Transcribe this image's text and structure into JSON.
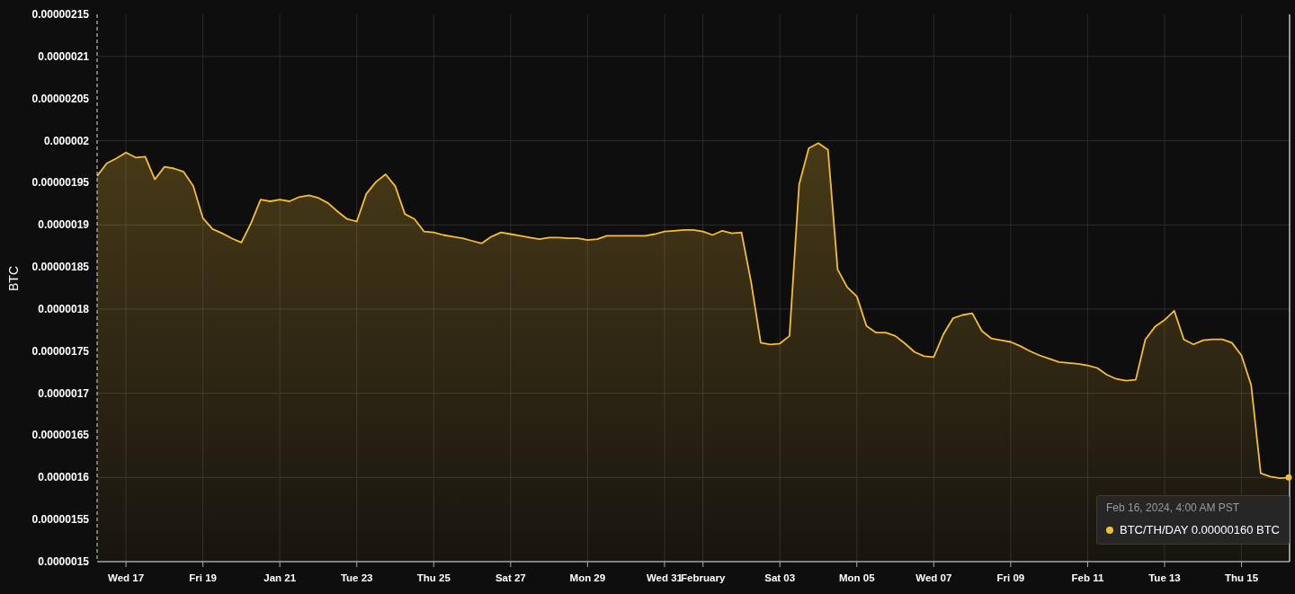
{
  "chart": {
    "chart_data": {
      "type": "area",
      "grid": true,
      "ylabel": "BTC",
      "ylim": [
        1.5e-06,
        2.15e-06
      ],
      "categories": [
        null,
        null,
        null,
        "Wed 17",
        null,
        null,
        null,
        null,
        null,
        null,
        null,
        "Fri 19",
        null,
        null,
        null,
        null,
        null,
        null,
        null,
        "Jan 21",
        null,
        null,
        null,
        null,
        null,
        null,
        null,
        "Tue 23",
        null,
        null,
        null,
        null,
        null,
        null,
        null,
        "Thu 25",
        null,
        null,
        null,
        null,
        null,
        null,
        null,
        "Sat 27",
        null,
        null,
        null,
        null,
        null,
        null,
        null,
        "Mon 29",
        null,
        null,
        null,
        null,
        null,
        null,
        null,
        "Wed 31",
        null,
        null,
        null,
        "February",
        null,
        null,
        null,
        null,
        null,
        null,
        null,
        "Sat 03",
        null,
        null,
        null,
        null,
        null,
        null,
        null,
        "Mon 05",
        null,
        null,
        null,
        null,
        null,
        null,
        null,
        "Wed 07",
        null,
        null,
        null,
        null,
        null,
        null,
        null,
        "Fri 09",
        null,
        null,
        null,
        null,
        null,
        null,
        null,
        "Feb 11",
        null,
        null,
        null,
        null,
        null,
        null,
        null,
        "Tue 13",
        null,
        null,
        null,
        null,
        null,
        null,
        null,
        "Thu 15",
        null,
        null,
        null,
        null,
        null
      ],
      "yticks": [
        {
          "value": 1.5e-06,
          "label": "0.0000015"
        },
        {
          "value": 1.55e-06,
          "label": "0.00000155"
        },
        {
          "value": 1.6e-06,
          "label": "0.0000016"
        },
        {
          "value": 1.65e-06,
          "label": "0.00000165"
        },
        {
          "value": 1.7e-06,
          "label": "0.0000017"
        },
        {
          "value": 1.75e-06,
          "label": "0.00000175"
        },
        {
          "value": 1.8e-06,
          "label": "0.0000018"
        },
        {
          "value": 1.85e-06,
          "label": "0.00000185"
        },
        {
          "value": 1.9e-06,
          "label": "0.0000019"
        },
        {
          "value": 1.95e-06,
          "label": "0.00000195"
        },
        {
          "value": 2e-06,
          "label": "0.000002"
        },
        {
          "value": 2.05e-06,
          "label": "0.00000205"
        },
        {
          "value": 2.1e-06,
          "label": "0.0000021"
        },
        {
          "value": 2.15e-06,
          "label": "0.00000215"
        }
      ],
      "series": [
        {
          "name": "BTC/TH/DAY",
          "color": "#f5be32",
          "values": [
            1.958e-06,
            1.973e-06,
            1.979e-06,
            1.986e-06,
            1.98e-06,
            1.981e-06,
            1.954e-06,
            1.969e-06,
            1.967e-06,
            1.963e-06,
            1.946e-06,
            1.908e-06,
            1.895e-06,
            1.89e-06,
            1.884e-06,
            1.879e-06,
            1.902e-06,
            1.93e-06,
            1.928e-06,
            1.93e-06,
            1.928e-06,
            1.933e-06,
            1.935e-06,
            1.932e-06,
            1.926e-06,
            1.916e-06,
            1.907e-06,
            1.904e-06,
            1.937e-06,
            1.951e-06,
            1.96e-06,
            1.946e-06,
            1.913e-06,
            1.907e-06,
            1.892e-06,
            1.891e-06,
            1.888e-06,
            1.886e-06,
            1.884e-06,
            1.881e-06,
            1.878e-06,
            1.886e-06,
            1.891e-06,
            1.889e-06,
            1.887e-06,
            1.885e-06,
            1.883e-06,
            1.885e-06,
            1.885e-06,
            1.884e-06,
            1.884e-06,
            1.882e-06,
            1.883e-06,
            1.887e-06,
            1.887e-06,
            1.887e-06,
            1.887e-06,
            1.887e-06,
            1.889e-06,
            1.892e-06,
            1.893e-06,
            1.894e-06,
            1.894e-06,
            1.892e-06,
            1.888e-06,
            1.893e-06,
            1.89e-06,
            1.891e-06,
            1.832e-06,
            1.76e-06,
            1.758e-06,
            1.759e-06,
            1.768e-06,
            1.948e-06,
            1.991e-06,
            1.997e-06,
            1.989e-06,
            1.847e-06,
            1.826e-06,
            1.815e-06,
            1.78e-06,
            1.772e-06,
            1.772e-06,
            1.768e-06,
            1.759e-06,
            1.749e-06,
            1.744e-06,
            1.743e-06,
            1.77e-06,
            1.789e-06,
            1.793e-06,
            1.795e-06,
            1.774e-06,
            1.765e-06,
            1.763e-06,
            1.761e-06,
            1.756e-06,
            1.75e-06,
            1.745e-06,
            1.741e-06,
            1.737e-06,
            1.736e-06,
            1.735e-06,
            1.733e-06,
            1.73e-06,
            1.722e-06,
            1.717e-06,
            1.715e-06,
            1.716e-06,
            1.764e-06,
            1.779e-06,
            1.787e-06,
            1.798e-06,
            1.764e-06,
            1.758e-06,
            1.763e-06,
            1.764e-06,
            1.764e-06,
            1.76e-06,
            1.745e-06,
            1.71e-06,
            1.605e-06,
            1.601e-06,
            1.599e-06,
            1.6e-06
          ]
        }
      ]
    },
    "tooltip": {
      "time": "Feb 16, 2024, 4:00 AM PST",
      "value": "0.00000160 BTC"
    }
  }
}
